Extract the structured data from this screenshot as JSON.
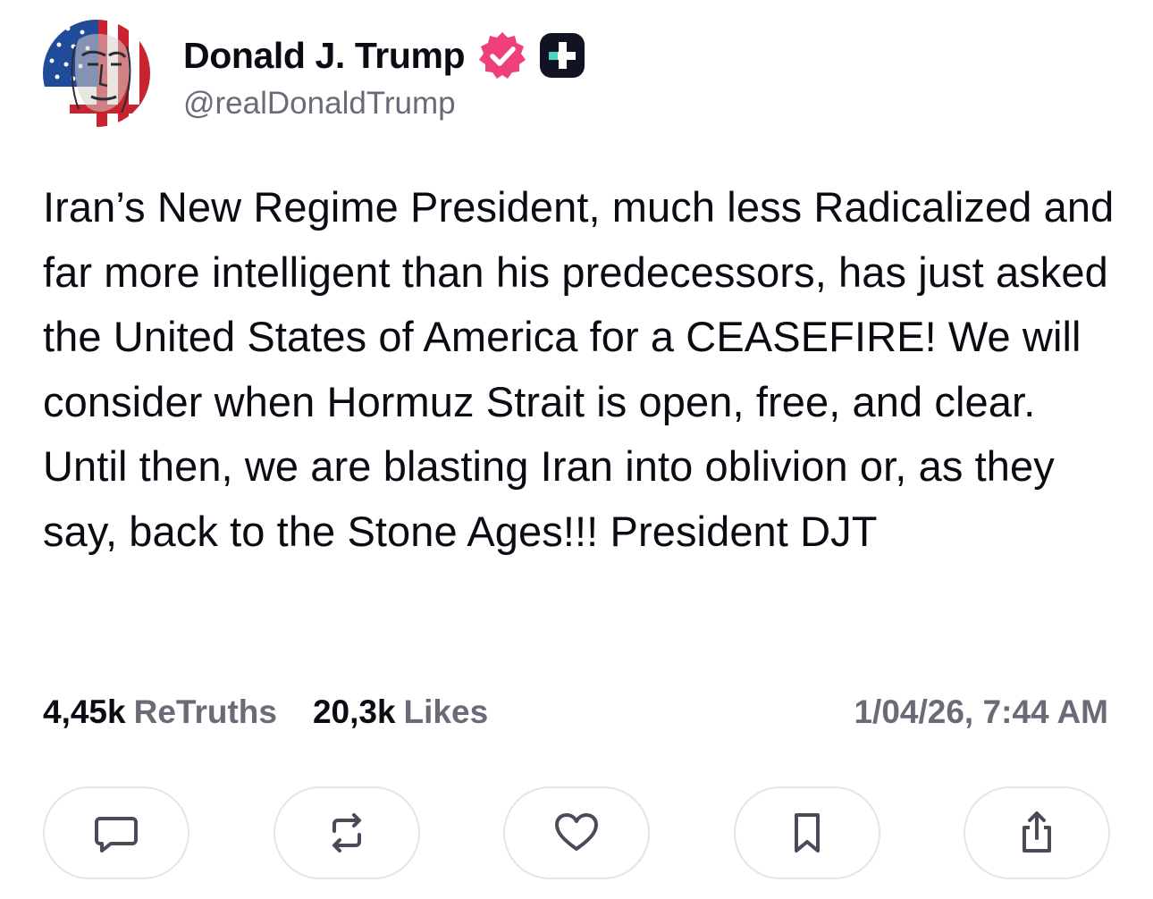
{
  "author": {
    "display_name": "Donald J. Trump",
    "handle": "@realDonaldTrump",
    "verified_icon": "verified-badge-icon",
    "verified_color": "#f0407a",
    "plus_icon": "truth-plus-badge-icon"
  },
  "post": {
    "text": "Iran’s New Regime President, much less Radicalized and far more intelligent than his predecessors, has just asked the United States of America for a CEASEFIRE! We will consider when Hormuz Strait is open, free, and clear. Until then, we are blasting Iran into oblivion or, as they say, back to the Stone Ages!!! President DJT"
  },
  "stats": {
    "retruths_count": "4,45k",
    "retruths_label": "ReTruths",
    "likes_count": "20,3k",
    "likes_label": "Likes",
    "timestamp": "1/04/26, 7:44 AM"
  },
  "actions": [
    {
      "name": "reply",
      "icon": "comment-icon"
    },
    {
      "name": "retruth",
      "icon": "repost-icon"
    },
    {
      "name": "like",
      "icon": "heart-icon"
    },
    {
      "name": "bookmark",
      "icon": "bookmark-icon"
    },
    {
      "name": "share",
      "icon": "share-icon"
    }
  ],
  "colors": {
    "text": "#0b0b14",
    "muted": "#6b6b78",
    "button_border": "#e4e4ea",
    "icon": "#4a4a58"
  }
}
